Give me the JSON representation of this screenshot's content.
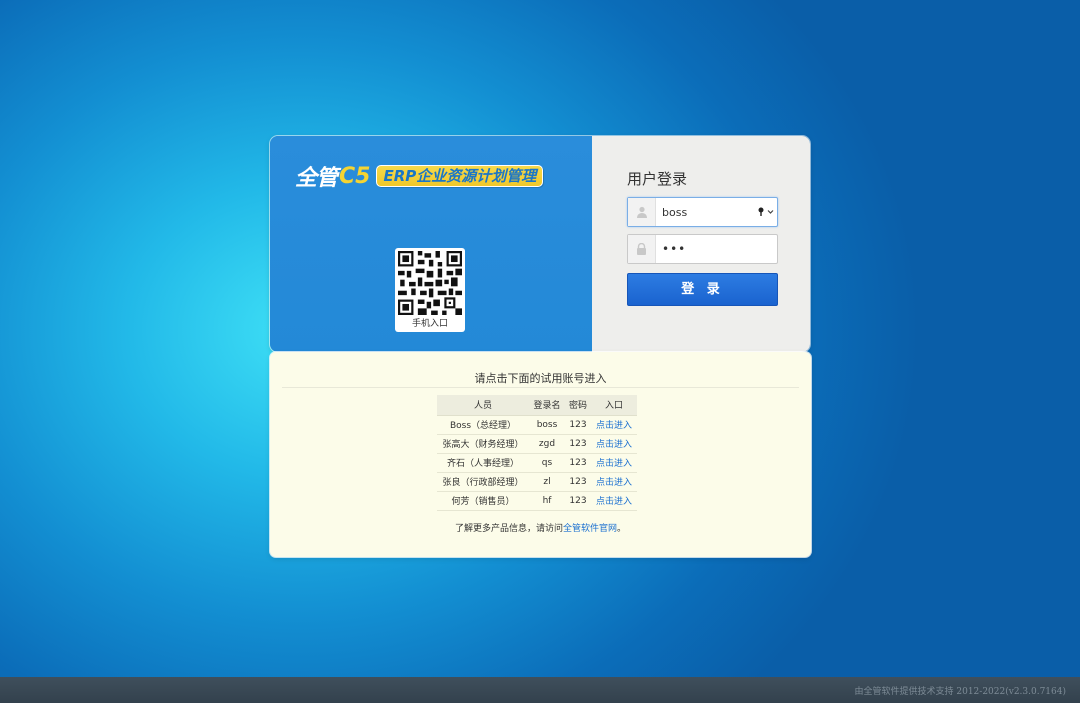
{
  "brand": {
    "name": "全管",
    "version": "C5",
    "tagline": "ERP企业资源计划管理",
    "qr_caption": "手机入口"
  },
  "login": {
    "title": "用户登录",
    "username_value": "boss",
    "password_value": "•••",
    "submit_label": "登 录",
    "icons": {
      "user": "user-icon",
      "lock": "lock-icon",
      "key": "key-icon",
      "dropdown": "chevron-down-icon"
    }
  },
  "trial": {
    "title": "请点击下面的试用账号进入",
    "headers": [
      "人员",
      "登录名",
      "密码",
      "入口"
    ],
    "rows": [
      [
        "Boss（总经理）",
        "boss",
        "123",
        "点击进入"
      ],
      [
        "张高大（财务经理）",
        "zgd",
        "123",
        "点击进入"
      ],
      [
        "齐石（人事经理）",
        "qs",
        "123",
        "点击进入"
      ],
      [
        "张良（行政部经理）",
        "zl",
        "123",
        "点击进入"
      ],
      [
        "何芳（销售员）",
        "hf",
        "123",
        "点击进入"
      ]
    ],
    "more_prefix": "了解更多产品信息，请访问",
    "more_link": "全管软件官网",
    "more_suffix": "。"
  },
  "footer": {
    "text": "由全管软件提供技术支持 2012-2022(v2.3.0.7164)"
  },
  "colors": {
    "brand_panel": "#2389d7",
    "login_button": "#1a63cf",
    "trial_bg": "#fcfce9",
    "link": "#1a6fd0",
    "footer_bg": "#33414d"
  }
}
